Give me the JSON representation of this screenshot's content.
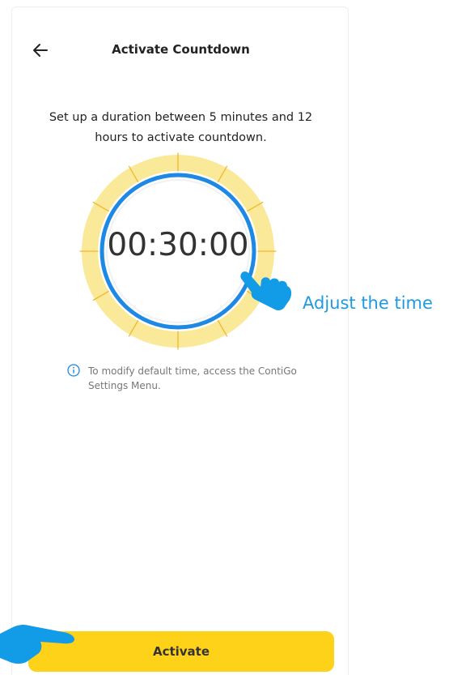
{
  "header": {
    "back_icon": "arrow-left-icon",
    "title": "Activate Countdown"
  },
  "main": {
    "description": "Set up a duration between 5 minutes and 12 hours to activate countdown.",
    "timer": {
      "value": "00:30:00"
    },
    "info_note": {
      "icon": "info-icon",
      "text": "To modify default time, access the ContiGo Settings Menu."
    }
  },
  "annotation": {
    "adjust_hint": "Adjust the time",
    "pointer_icon": "pointing-hand-icon"
  },
  "footer": {
    "activate_label": "Activate"
  },
  "colors": {
    "accent_yellow": "#ffd21a",
    "dial_ring_yellow": "#fbe99a",
    "tick_orange": "#f2b72b",
    "dial_blue": "#1e88e5",
    "hint_blue": "#1e9be0",
    "hand_blue": "#129be6"
  }
}
